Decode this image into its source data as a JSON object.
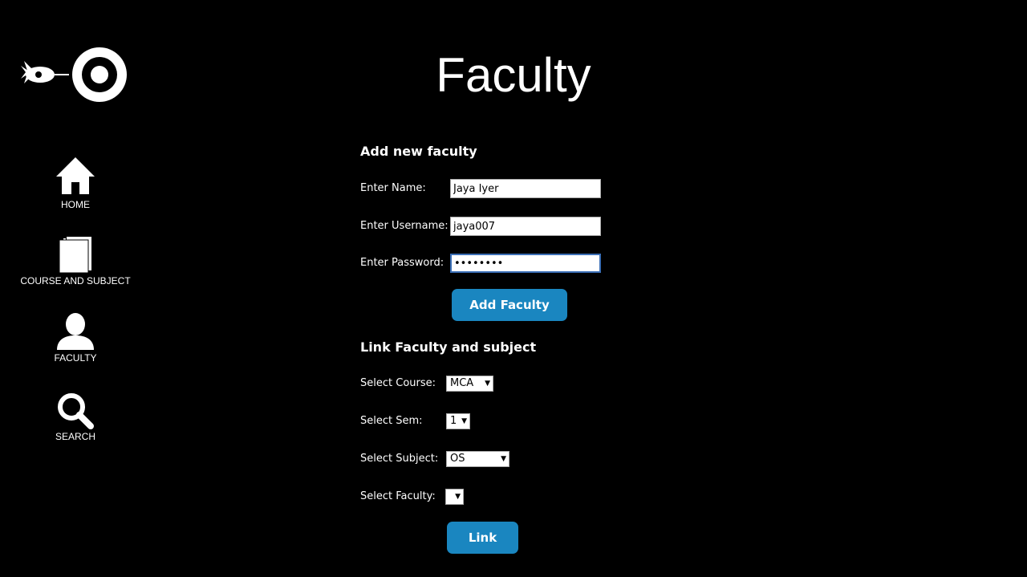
{
  "page": {
    "title": "Faculty"
  },
  "sidebar": {
    "items": [
      {
        "label": "HOME",
        "icon": "home-icon"
      },
      {
        "label": "COURSE AND SUBJECT",
        "icon": "book-icon"
      },
      {
        "label": "FACULTY",
        "icon": "user-icon"
      },
      {
        "label": "SEARCH",
        "icon": "search-icon"
      }
    ]
  },
  "add_faculty": {
    "heading": "Add new faculty",
    "name_label": "Enter Name:",
    "name_value": "Jaya Iyer",
    "username_label": "Enter Username:",
    "username_value": "jaya007",
    "password_label": "Enter Password:",
    "password_value": "jaya1234",
    "button_label": "Add Faculty"
  },
  "link_faculty": {
    "heading": "Link Faculty and subject",
    "course_label": "Select Course:",
    "course_value": "MCA",
    "sem_label": "Select Sem:",
    "sem_value": "1",
    "subject_label": "Select Subject:",
    "subject_value": "OS",
    "faculty_label": "Select Faculty:",
    "faculty_value": "",
    "button_label": "Link"
  },
  "colors": {
    "background": "#000000",
    "button": "#1a86c0",
    "text": "#ffffff"
  }
}
